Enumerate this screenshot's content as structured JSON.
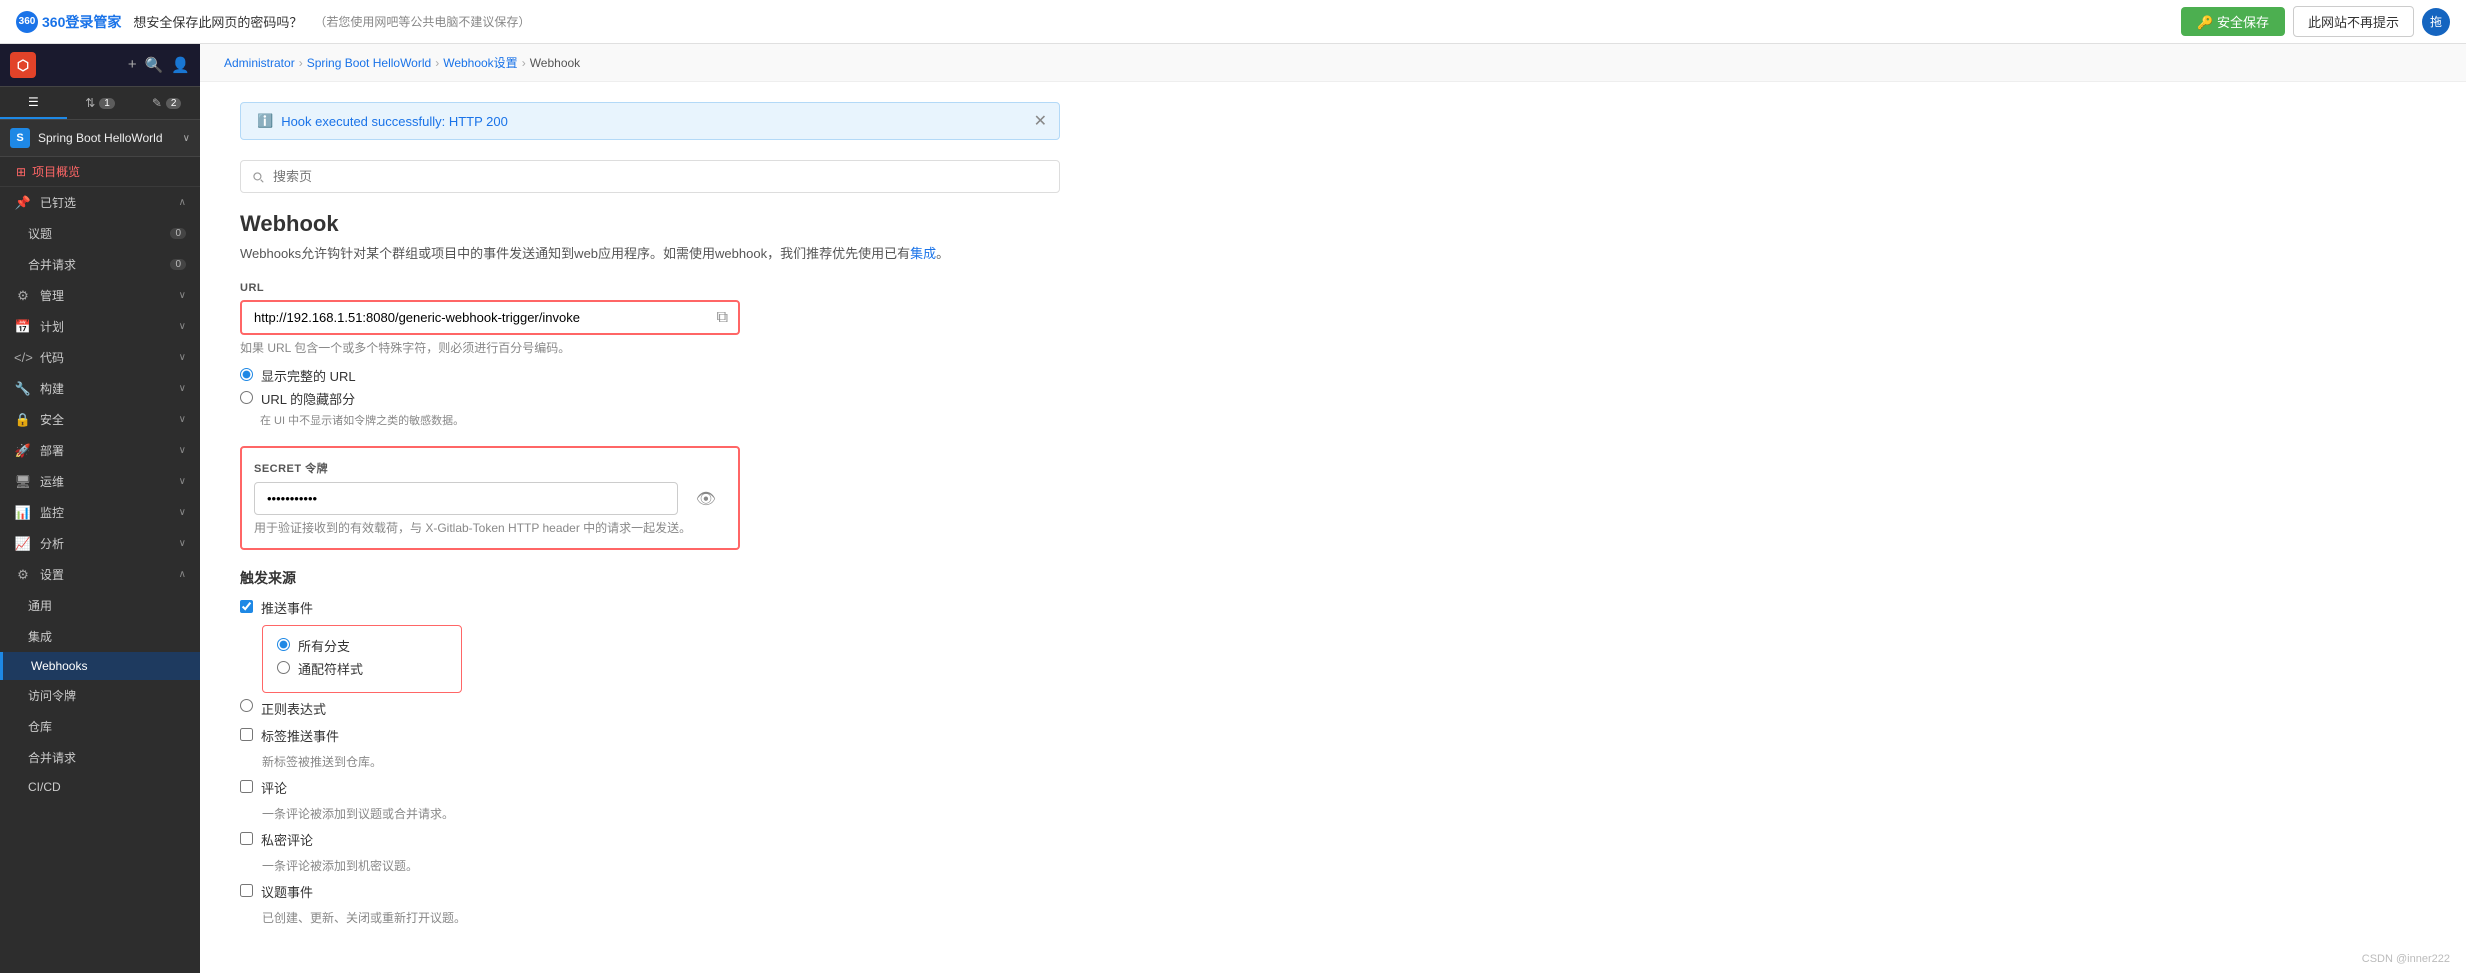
{
  "topbar": {
    "logo_text": "360登录管家",
    "question": "想安全保存此网页的密码吗？",
    "hint": "（若您使用网吧等公共电脑不建议保存）",
    "save_label": "🔑 安全保存",
    "no_remind_label": "此网站不再提示",
    "avatar_text": "拖"
  },
  "sidebar": {
    "project_name": "Spring Boot HelloWorld",
    "tabs": [
      {
        "icon": "☰",
        "label": ""
      },
      {
        "icon": "↕ 1",
        "label": ""
      },
      {
        "icon": "✎ 2",
        "label": ""
      }
    ],
    "overview_link": "项目概览",
    "sections": [
      {
        "label": "已钉选",
        "icon": "📌",
        "chevron": "∧",
        "children": [
          {
            "label": "议题",
            "count": "0"
          },
          {
            "label": "合并请求",
            "count": "0"
          }
        ]
      },
      {
        "label": "管理",
        "icon": "⚙",
        "chevron": "∨"
      },
      {
        "label": "计划",
        "icon": "📅",
        "chevron": "∨"
      },
      {
        "label": "代码",
        "icon": "< >",
        "chevron": "∨"
      },
      {
        "label": "构建",
        "icon": "🔧",
        "chevron": "∨"
      },
      {
        "label": "安全",
        "icon": "🔒",
        "chevron": "∨"
      },
      {
        "label": "部署",
        "icon": "🚀",
        "chevron": "∨"
      },
      {
        "label": "运维",
        "icon": "🖥",
        "chevron": "∨"
      },
      {
        "label": "监控",
        "icon": "📊",
        "chevron": "∨"
      },
      {
        "label": "分析",
        "icon": "📈",
        "chevron": "∨"
      },
      {
        "label": "设置",
        "icon": "⚙",
        "chevron": "∧",
        "expanded": true,
        "children": [
          {
            "label": "通用"
          },
          {
            "label": "集成"
          },
          {
            "label": "Webhooks",
            "active": true
          },
          {
            "label": "访问令牌"
          },
          {
            "label": "仓库"
          },
          {
            "label": "合并请求"
          },
          {
            "label": "CI/CD"
          }
        ]
      }
    ]
  },
  "breadcrumb": [
    {
      "label": "Administrator",
      "href": "#"
    },
    {
      "label": "Spring Boot HelloWorld",
      "href": "#"
    },
    {
      "label": "Webhook设置",
      "href": "#"
    },
    {
      "label": "Webhook",
      "href": "#"
    }
  ],
  "success_banner": {
    "message": "Hook executed successfully: HTTP 200"
  },
  "search": {
    "placeholder": "搜索页"
  },
  "page": {
    "title": "Webhook",
    "description_parts": [
      "Webhooks允许钩针对某个群组或项目中的事件发送通知到web应用程序。如需使用webhook，我们推荐优先使用已有",
      "集成",
      "。"
    ]
  },
  "form": {
    "url_label": "URL",
    "url_value": "http://192.168.1.51:8080/generic-webhook-trigger/invoke",
    "url_hint": "如果 URL 包含一个或多个特殊字符，则必须进行百分号编码。",
    "url_radio_full": "显示完整的 URL",
    "url_radio_masked": "URL 的隐藏部分",
    "url_radio_masked_hint": "在 UI 中不显示诸如令牌之类的敏感数据。",
    "secret_label": "Secret 令牌",
    "secret_value": "••••••••••••",
    "secret_hint": "用于验证接收到的有效载荷，与 X-Gitlab-Token HTTP header 中的请求一起发送。",
    "trigger_label": "触发来源",
    "push_events_label": "推送事件",
    "push_events_checked": true,
    "all_branches_label": "所有分支",
    "match_pattern_label": "通配符样式",
    "regex_label": "正则表达式",
    "tag_push_label": "标签推送事件",
    "tag_push_hint": "新标签被推送到仓库。",
    "comment_label": "评论",
    "comment_hint": "一条评论被添加到议题或合并请求。",
    "confidential_comment_label": "私密评论",
    "confidential_comment_hint": "一条评论被添加到机密议题。",
    "issue_label": "议题事件",
    "issue_hint": "已创建、更新、关闭或重新打开议题。"
  },
  "watermark": "CSDN @inner222"
}
